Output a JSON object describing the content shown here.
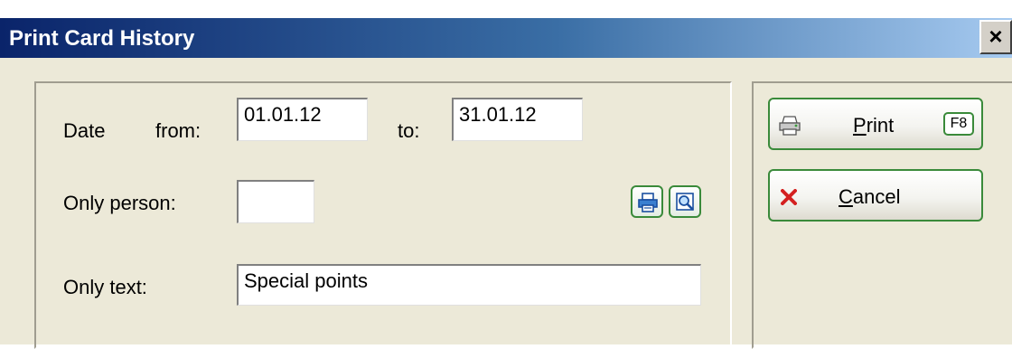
{
  "window": {
    "title": "Print Card History",
    "close_glyph": "✕"
  },
  "form": {
    "date_label": "Date",
    "from_label": "from:",
    "from_value": "01.01.12",
    "to_label": "to:",
    "to_value": "31.01.12",
    "person_label": "Only person:",
    "person_value": "",
    "text_label": "Only text:",
    "text_value": "Special points"
  },
  "buttons": {
    "print_label_first": "P",
    "print_label_rest": "rint",
    "print_hotkey": "F8",
    "cancel_label_first": "C",
    "cancel_label_rest": "ancel"
  },
  "icons": {
    "small_print": "printer-icon",
    "small_preview": "magnifier-icon",
    "print_button": "printer-icon",
    "cancel_button": "x-cross-icon"
  },
  "colors": {
    "accent_green": "#3a8a3a",
    "titlebar_start": "#0a246a",
    "titlebar_end": "#a6caf0",
    "cancel_red": "#d42020"
  }
}
